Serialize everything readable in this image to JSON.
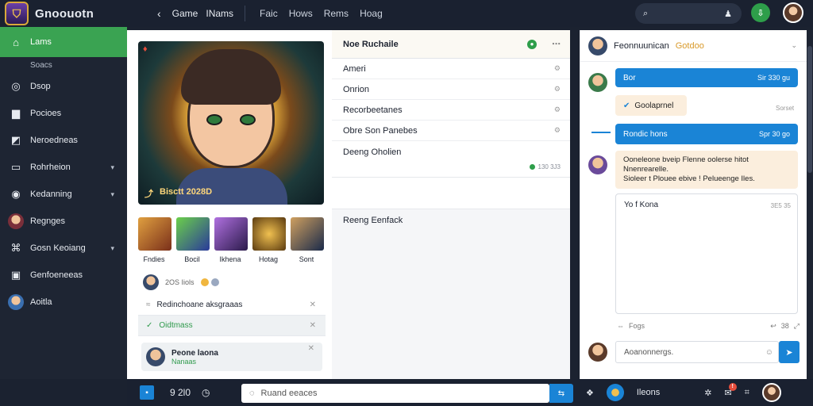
{
  "topbar": {
    "brand": "Gnoouotn",
    "crumbs": [
      "Game",
      "INams"
    ],
    "nav": [
      "Faic",
      "Hows",
      "Rems",
      "Hoag"
    ]
  },
  "sidebar": {
    "items": [
      {
        "label": "Lams",
        "icon": "home-icon",
        "active": true
      },
      {
        "label": "Dsop",
        "icon": "compass-icon"
      },
      {
        "label": "Pocioes",
        "icon": "folder-icon"
      },
      {
        "label": "Neroedneas",
        "icon": "chart-icon"
      },
      {
        "label": "Rohrheion",
        "icon": "monitor-icon",
        "caret": true
      },
      {
        "label": "Kedanning",
        "icon": "globe-icon",
        "caret": true
      },
      {
        "label": "Regnges",
        "icon": "avatar"
      },
      {
        "label": "Gosn Keoiang",
        "icon": "gamepad-icon",
        "caret": true
      },
      {
        "label": "Genfoeneeas",
        "icon": "briefcase-icon"
      },
      {
        "label": "Aoitla",
        "icon": "group-avatar"
      }
    ],
    "sub": "Soacs"
  },
  "hero": {
    "caption": "Bisctt 2028D",
    "thumbs": [
      {
        "label": "Fndies",
        "color": "#c2742a"
      },
      {
        "label": "Bocil",
        "color": "#4a6bb0"
      },
      {
        "label": "Ikhena",
        "color": "#5a3a8a"
      },
      {
        "label": "Hotag",
        "color": "#9a6a2a"
      },
      {
        "label": "Sont",
        "color": "#3a5a7a"
      }
    ],
    "meta": "2OS Iiols"
  },
  "left_list": {
    "row1": "Redinchoane aksgraaas",
    "row2": "Oidtmass",
    "card_title": "Peone laona",
    "card_sub": "Nanaas"
  },
  "middle": {
    "header": "Noe Ruchaile",
    "rows": [
      "Ameri",
      "Onrion",
      "Recorbeetanes",
      "Obre Son Panebes"
    ],
    "section1": "Deeng Oholien",
    "section1_time": "130 3J3",
    "section2": "Reeng Eenfack"
  },
  "chat": {
    "header": "Feonnuunican",
    "header_accent": "Gotdoo",
    "msg1": "Bor",
    "msg1_time": "Sir 330 gu",
    "msg2": "Goolaprnel",
    "msg2_time": "Sorset",
    "msg3": "Rondic hons",
    "msg3_time": "Spr 30 go",
    "msg4_line1": "Ooneleone bveip  Flenne oolerse hitot",
    "msg4_line2": "Nnenrearelle.",
    "msg4_line3": "Sioleer t Plouee ebive ! Pelueenge Iles.",
    "draft": "Yo f Kona",
    "draft_time": "3E5 35",
    "foot_left": "Fogs",
    "foot_right": "38",
    "input_placeholder": "Aoanonnergs."
  },
  "bottombar": {
    "count": "9 2l0",
    "search_placeholder": "Ruand eeaces",
    "right_label": "Ileons"
  }
}
